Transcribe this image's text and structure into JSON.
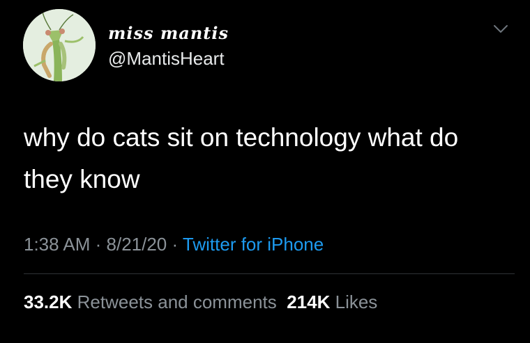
{
  "author": {
    "display_name": "miss mantis",
    "handle": "@MantisHeart",
    "avatar_icon": "praying-mantis-avatar"
  },
  "tweet": {
    "text": "why do cats sit on technology what do they know"
  },
  "meta": {
    "time": "1:38 AM",
    "separator1": " · ",
    "date": "8/21/20",
    "separator2": " · ",
    "source": "Twitter for iPhone"
  },
  "stats": {
    "retweets_count": "33.2K",
    "retweets_label": "Retweets and comments",
    "likes_count": "214K",
    "likes_label": "Likes"
  },
  "colors": {
    "background": "#000000",
    "text": "#ffffff",
    "muted": "#8b9298",
    "link": "#1d9bf0",
    "divider": "#2f3336"
  },
  "icons": {
    "menu": "chevron-down-icon"
  }
}
